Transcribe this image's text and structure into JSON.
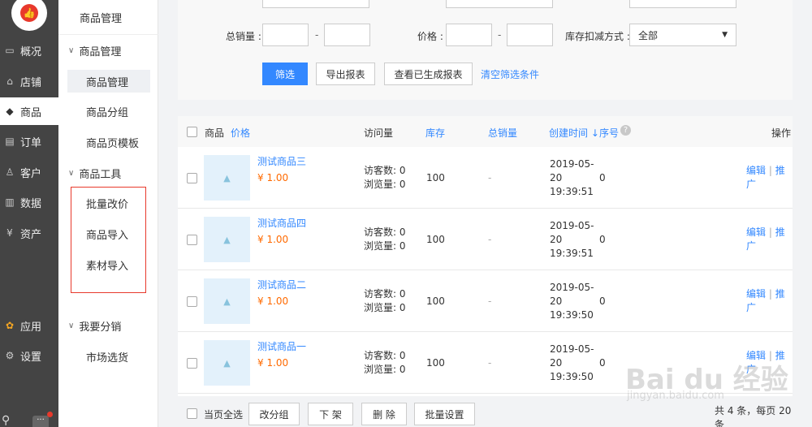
{
  "nav_primary": {
    "items": [
      {
        "label": "概况",
        "icon": "screen-icon"
      },
      {
        "label": "店铺",
        "icon": "store-icon"
      },
      {
        "label": "商品",
        "icon": "tag-icon"
      },
      {
        "label": "订单",
        "icon": "list-icon"
      },
      {
        "label": "客户",
        "icon": "user-icon"
      },
      {
        "label": "数据",
        "icon": "bar-chart-icon"
      },
      {
        "label": "资产",
        "icon": "yen-icon"
      },
      {
        "label": "应用",
        "icon": "apps-icon"
      },
      {
        "label": "设置",
        "icon": "gear-icon"
      }
    ]
  },
  "nav_secondary": {
    "header": "商品管理",
    "group1": "商品管理",
    "items1": [
      "商品管理",
      "商品分组",
      "商品页模板"
    ],
    "group2": "商品工具",
    "items2": [
      "批量改价",
      "商品导入",
      "素材导入"
    ],
    "group3": "我要分销",
    "items3": [
      "市场选货"
    ]
  },
  "filter": {
    "total_sales_label": "总销量 :",
    "price_label": "价格 :",
    "stock_method_label": "库存扣减方式 :",
    "stock_method_value": "全部",
    "range_sep": "-",
    "btn_filter": "筛选",
    "btn_export": "导出报表",
    "btn_view": "查看已生成报表",
    "link_clear": "清空筛选条件"
  },
  "table": {
    "headers": {
      "product": "商品",
      "price": "价格",
      "visits": "访问量",
      "stock": "库存",
      "total_sales": "总销量",
      "created": "创建时间 ↓",
      "seq": "序号",
      "ops": "操作"
    },
    "rows": [
      {
        "name": "测试商品三",
        "price": "¥ 1.00",
        "visitors": "访客数: 0",
        "views": "浏览量: 0",
        "stock": "100",
        "sales": "-",
        "date1": "2019-05-",
        "date2": "20",
        "date3": "19:39:51",
        "seq": "0",
        "edit": "编辑",
        "sep": "|",
        "promote": "推广"
      },
      {
        "name": "测试商品四",
        "price": "¥ 1.00",
        "visitors": "访客数: 0",
        "views": "浏览量: 0",
        "stock": "100",
        "sales": "-",
        "date1": "2019-05-",
        "date2": "20",
        "date3": "19:39:51",
        "seq": "0",
        "edit": "编辑",
        "sep": "|",
        "promote": "推广"
      },
      {
        "name": "测试商品二",
        "price": "¥ 1.00",
        "visitors": "访客数: 0",
        "views": "浏览量: 0",
        "stock": "100",
        "sales": "-",
        "date1": "2019-05-",
        "date2": "20",
        "date3": "19:39:50",
        "seq": "0",
        "edit": "编辑",
        "sep": "|",
        "promote": "推广"
      },
      {
        "name": "测试商品一",
        "price": "¥ 1.00",
        "visitors": "访客数: 0",
        "views": "浏览量: 0",
        "stock": "100",
        "sales": "-",
        "date1": "2019-05-",
        "date2": "20",
        "date3": "19:39:50",
        "seq": "0",
        "edit": "编辑",
        "sep": "|",
        "promote": "推广"
      }
    ]
  },
  "footer": {
    "select_all": "当页全选",
    "btn_group": "改分组",
    "btn_off": "下 架",
    "btn_delete": "删 除",
    "btn_batch": "批量设置",
    "summary": "共 4 条，每页 20 条"
  },
  "watermark": {
    "main": "Bai du 经验",
    "sub": "jingyan.baidu.com"
  },
  "colors": {
    "accent": "#3388ff",
    "price": "#ff6a00",
    "logo": "#e8392c",
    "sidebar": "#444444"
  }
}
